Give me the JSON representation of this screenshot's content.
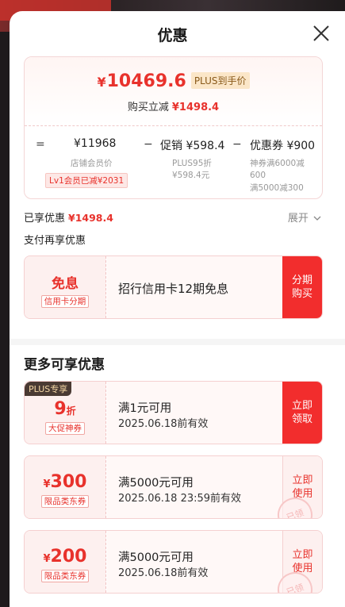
{
  "header": {
    "title": "优惠"
  },
  "summary": {
    "currency": "¥",
    "final_int": "10469",
    "final_dec": ".6",
    "plus_tag": "PLUS到手价",
    "reduce_label": "购买立减",
    "reduce_amount": "¥1498.4"
  },
  "calc": {
    "eq": "=",
    "store_price": "¥11968",
    "store_label": "店铺会员价",
    "member_note": "Lv1会员已减¥2031",
    "minus1": "−",
    "promo": "促销 ¥598.4",
    "promo_sub1": "PLUS95折",
    "promo_sub2": "¥598.4元",
    "minus2": "−",
    "coupon": "优惠券 ¥900",
    "coupon_sub1": "神券满6000减",
    "coupon_sub2": "600",
    "coupon_sub3": "满5000减300"
  },
  "enjoyed": {
    "label": "已享优惠",
    "amount": "¥1498.4",
    "expand": "展开"
  },
  "pay_again": "支付再享优惠",
  "installment": {
    "title": "免息",
    "tag": "信用卡分期",
    "desc": "招行信用卡12期免息",
    "btn": "分期\n购买"
  },
  "more": {
    "title": "更多可享优惠",
    "coupons": [
      {
        "badge": "PLUS专享",
        "value": "9",
        "unit": "折",
        "tag": "大促神券",
        "cond": "满1元可用",
        "valid": "2025.06.18前有效",
        "btn_l1": "立即",
        "btn_l2": "领取",
        "style": "red"
      },
      {
        "currency": "¥",
        "value": "300",
        "tag": "限品类东券",
        "cond": "满5000元可用",
        "valid": "2025.06.18 23:59前有效",
        "btn_l1": "立即",
        "btn_l2": "使用",
        "style": "light",
        "stamp": "已领"
      },
      {
        "currency": "¥",
        "value": "200",
        "tag": "限品类东券",
        "cond": "满5000元可用",
        "valid": "2025.06.18前有效",
        "btn_l1": "立即",
        "btn_l2": "使用",
        "style": "light",
        "stamp": "已领"
      }
    ]
  },
  "colors": {
    "accent": "#e8322c",
    "button_red": "#f22d2d",
    "plus_gold": "#fbe6c8"
  }
}
